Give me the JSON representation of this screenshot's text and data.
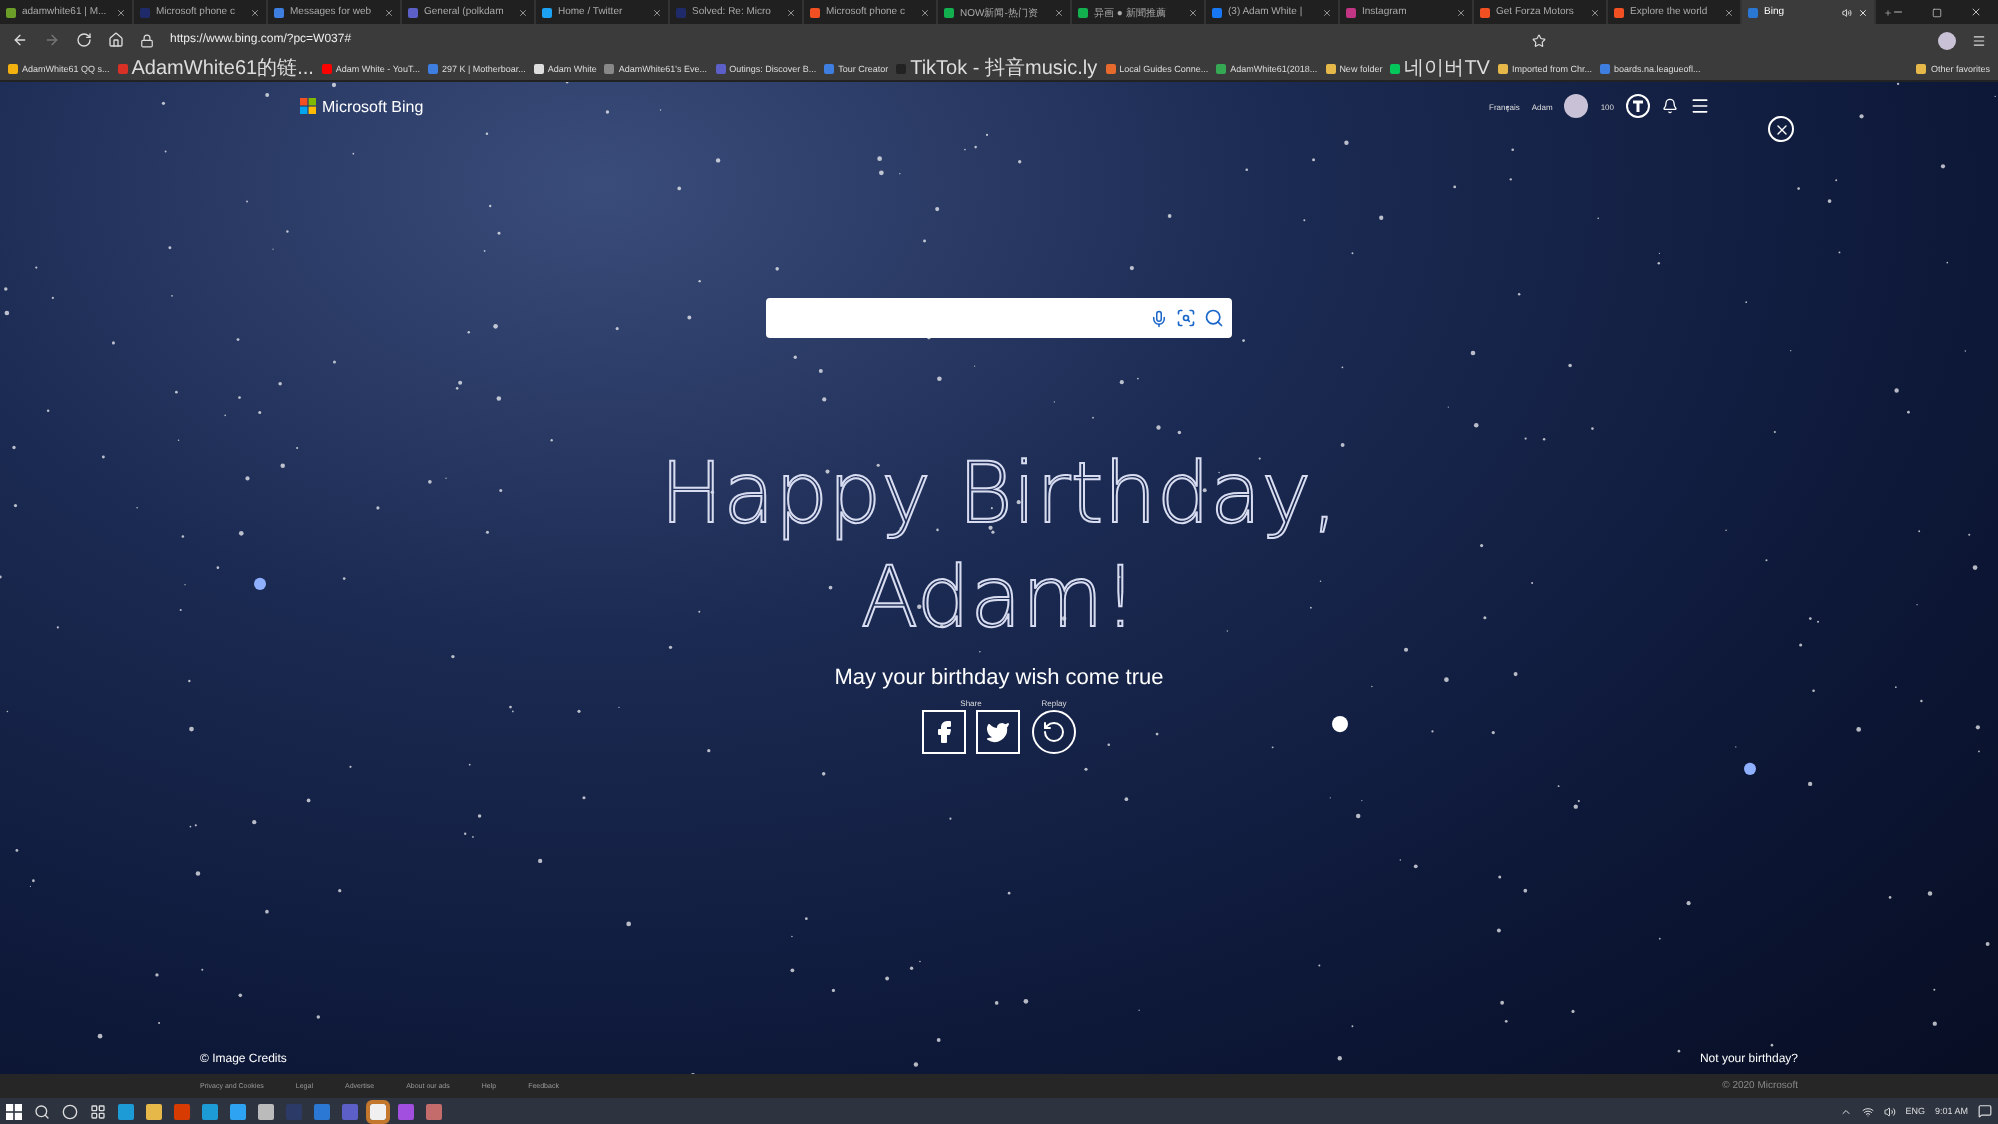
{
  "browser": {
    "tabs": [
      {
        "title": "adamwhite61 | M...",
        "selected": false
      },
      {
        "title": "Microsoft phone c",
        "selected": false
      },
      {
        "title": "Messages for web",
        "selected": false
      },
      {
        "title": "General (polkdam",
        "selected": false
      },
      {
        "title": "Home / Twitter",
        "selected": false
      },
      {
        "title": "Solved: Re: Micro",
        "selected": false
      },
      {
        "title": "Microsoft phone c",
        "selected": false
      },
      {
        "title": "NOW新闻-热门资",
        "selected": false
      },
      {
        "title": "异画 ● 新聞推薦",
        "selected": false
      },
      {
        "title": "(3) Adam White |",
        "selected": false
      },
      {
        "title": "Instagram",
        "selected": false
      },
      {
        "title": "Get Forza Motors",
        "selected": false
      },
      {
        "title": "Explore the world",
        "selected": false
      },
      {
        "title": "Bing",
        "selected": true
      }
    ],
    "url": "https://www.bing.com/?pc=W037#",
    "bookmarks": [
      "AdamWhite61 QQ s...",
      "AdamWhite61的链...",
      "Adam White - YouT...",
      "297 K | Motherboar...",
      "Adam White",
      "AdamWhite61's Eve...",
      "Outings: Discover B...",
      "Tour Creator",
      "TikTok - 抖音music.ly",
      "Local Guides Conne...",
      "AdamWhite61(2018...",
      "New folder",
      "네이버TV",
      "Imported from Chr...",
      "boards.na.leagueofl..."
    ],
    "other_favorites": "Other favorites"
  },
  "header": {
    "logo": "Microsoft Bing",
    "language": "Français",
    "user": "Adam",
    "points": "100"
  },
  "greeting": {
    "line1": "Happy Birthday,",
    "line2": "Adam!",
    "subtitle": "May your birthday wish come true",
    "share_label": "Share",
    "replay_label": "Replay"
  },
  "image_credits": "© Image Credits",
  "not_birthday": "Not your birthday?",
  "footer": {
    "links": [
      "Privacy and Cookies",
      "Legal",
      "Advertise",
      "About our ads",
      "Help",
      "Feedback"
    ],
    "copyright": "© 2020 Microsoft"
  },
  "taskbar": {
    "language": "ENG",
    "time": "9:01 AM"
  }
}
